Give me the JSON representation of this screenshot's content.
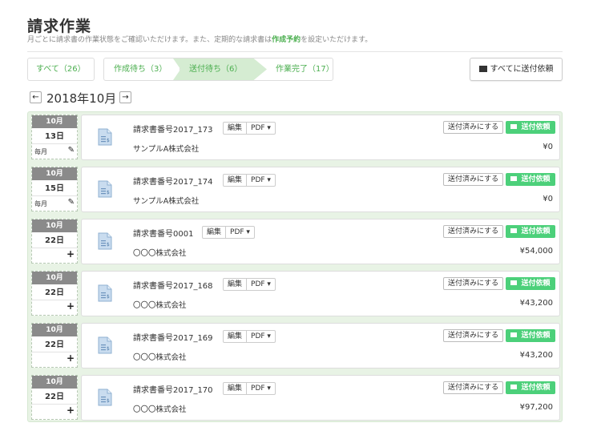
{
  "page": {
    "title": "請求作業",
    "subtitle_before": "月ごとに請求書の作業状態をご確認いただけます。また、定期的な請求書は",
    "subtitle_link": "作成予約",
    "subtitle_after": "を設定いただけます。"
  },
  "tabs": {
    "all": "すべて（26）",
    "creating": "作成待ち（3）",
    "sending": "送付待ち（6）",
    "done": "作業完了（17）"
  },
  "send_all_label": "すべてに送付依頼",
  "month_nav": {
    "prev": "←",
    "label": "2018年10月",
    "next": "→"
  },
  "row_labels": {
    "edit": "編集",
    "pdf": "PDF ▾",
    "mark_sent": "送付済みにする",
    "send_request": "送付依頼"
  },
  "invoices": [
    {
      "month": "10月",
      "day": "13日",
      "recurring": "毎月",
      "title": "請求書番号2017_173",
      "company": "サンプルA株式会社",
      "amount": "¥0"
    },
    {
      "month": "10月",
      "day": "15日",
      "recurring": "毎月",
      "title": "請求書番号2017_174",
      "company": "サンプルA株式会社",
      "amount": "¥0"
    },
    {
      "month": "10月",
      "day": "22日",
      "recurring": "",
      "title": "請求書番号0001",
      "company": "〇〇〇株式会社",
      "amount": "¥54,000"
    },
    {
      "month": "10月",
      "day": "22日",
      "recurring": "",
      "title": "請求書番号2017_168",
      "company": "〇〇〇株式会社",
      "amount": "¥43,200"
    },
    {
      "month": "10月",
      "day": "22日",
      "recurring": "",
      "title": "請求書番号2017_169",
      "company": "〇〇〇株式会社",
      "amount": "¥43,200"
    },
    {
      "month": "10月",
      "day": "22日",
      "recurring": "",
      "title": "請求書番号2017_170",
      "company": "〇〇〇株式会社",
      "amount": "¥97,200"
    }
  ],
  "colors": {
    "accent_green": "#4caf50",
    "send_button": "#4cd07a",
    "list_background": "#e8f3e5"
  }
}
